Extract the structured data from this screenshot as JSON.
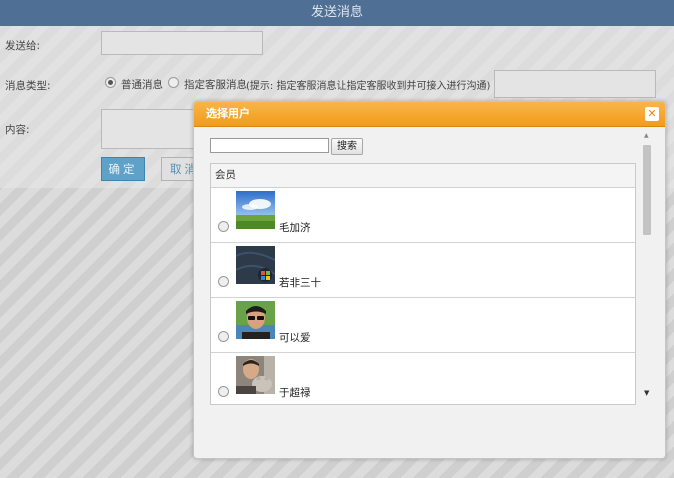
{
  "header": {
    "title": "发送消息"
  },
  "form": {
    "recipient_label": "发送给:",
    "type_label": "消息类型:",
    "type_options": [
      "普通消息",
      "指定客服消息"
    ],
    "selected_type": "普通消息",
    "hint": "(提示: 指定客服消息让指定客服收到并可接入进行沟通)",
    "content_label": "内容:",
    "ok_label": "确定",
    "cancel_label": "取消"
  },
  "dialog": {
    "title": "选择用户",
    "close_icon": "close-icon",
    "search_placeholder": "",
    "search_button": "搜索",
    "list_header": "会员",
    "users": [
      {
        "name": "毛加济",
        "avatar": "landscape-avatar"
      },
      {
        "name": "若非三十",
        "avatar": "windows-logo-avatar"
      },
      {
        "name": "可以爱",
        "avatar": "sunglasses-person-avatar"
      },
      {
        "name": "于超禄",
        "avatar": "person-with-cat-avatar"
      }
    ]
  },
  "colors": {
    "header_bg": "#4f6f94",
    "dialog_header": "#f39b19",
    "ok_button": "#5ea1c9"
  }
}
